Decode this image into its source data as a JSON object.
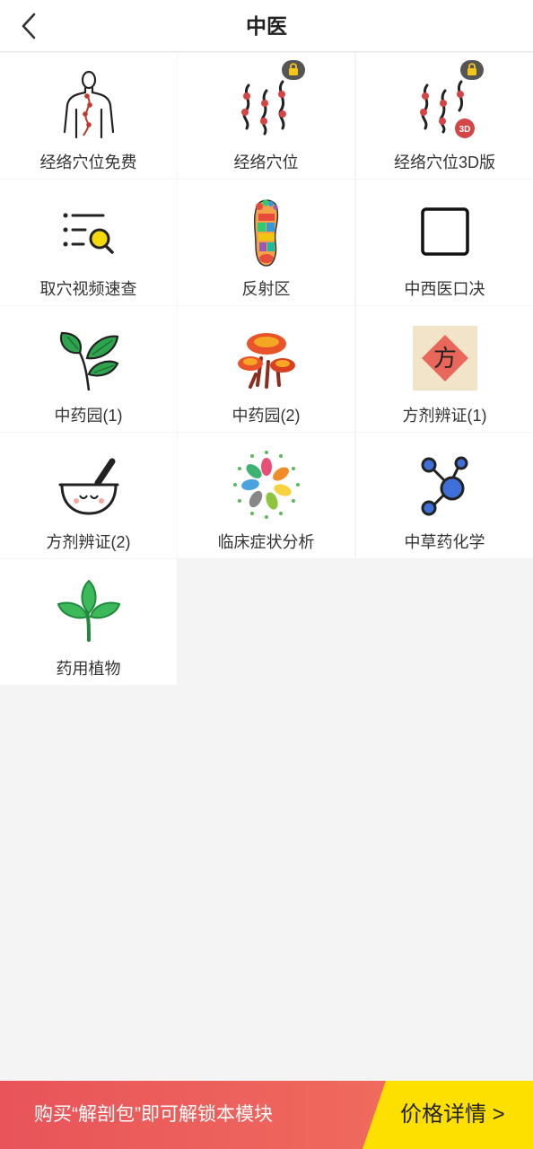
{
  "header": {
    "title": "中医",
    "back_icon": "chevron-left-icon"
  },
  "grid": {
    "items": [
      {
        "label": "经络穴位免费",
        "icon": "meridian-body-icon",
        "locked": false
      },
      {
        "label": "经络穴位",
        "icon": "acupoint-chain-icon",
        "locked": true
      },
      {
        "label": "经络穴位3D版",
        "icon": "acupoint-3d-icon",
        "locked": true,
        "badge": "3D"
      },
      {
        "label": "取穴视频速查",
        "icon": "list-search-icon",
        "locked": false
      },
      {
        "label": "反射区",
        "icon": "foot-reflexology-icon",
        "locked": false
      },
      {
        "label": "中西医口决",
        "icon": "square-outline-icon",
        "locked": false
      },
      {
        "label": "中药园(1)",
        "icon": "leaves-icon",
        "locked": false
      },
      {
        "label": "中药园(2)",
        "icon": "mushroom-icon",
        "locked": false
      },
      {
        "label": "方剂辨证(1)",
        "icon": "fang-character-icon",
        "locked": false,
        "glyph": "方"
      },
      {
        "label": "方剂辨证(2)",
        "icon": "mortar-pestle-icon",
        "locked": false
      },
      {
        "label": "临床症状分析",
        "icon": "leaf-wreath-icon",
        "locked": false
      },
      {
        "label": "中草药化学",
        "icon": "molecule-icon",
        "locked": false
      },
      {
        "label": "药用植物",
        "icon": "green-sprout-icon",
        "locked": false
      }
    ]
  },
  "bottom_bar": {
    "promo_text": "购买“解剖包”即可解锁本模块",
    "price_label": "价格详情 >",
    "colors": {
      "promo": "#ee5f5c",
      "price": "#fde000"
    }
  }
}
